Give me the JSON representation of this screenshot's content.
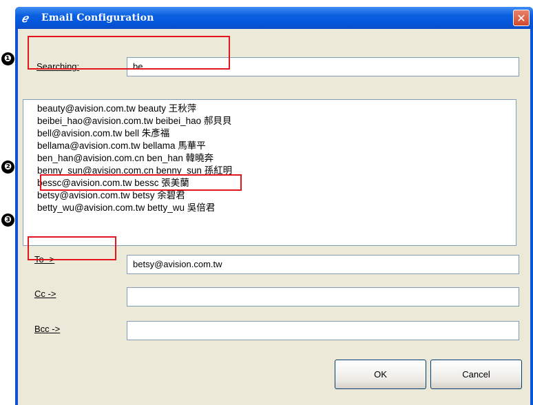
{
  "markers": [
    "❶",
    "❷",
    "❸"
  ],
  "window": {
    "title": "Email Configuration",
    "icon": "feather-pen-icon",
    "close_glyph": "✕"
  },
  "search": {
    "label": "Searching:",
    "value": "be"
  },
  "contacts": [
    "beauty@avision.com.tw beauty 王秋萍",
    "beibei_hao@avision.com.tw beibei_hao 郝貝貝",
    "bell@avision.com.tw bell 朱彥福",
    "bellama@avision.com.tw bellama 馬華平",
    "ben_han@avision.com.cn ben_han 韓曉奔",
    "benny_sun@avision.com.cn benny_sun 孫紅明",
    "bessc@avision.com.tw bessc 張美蘭",
    "betsy@avision.com.tw betsy 余碧君",
    "betty_wu@avision.com.tw betty_wu 吳倍君"
  ],
  "to": {
    "label": "To ->",
    "value": "betsy@avision.com.tw"
  },
  "cc": {
    "label": "Cc ->",
    "value": ""
  },
  "bcc": {
    "label": "Bcc ->",
    "value": ""
  },
  "buttons": {
    "ok": "OK",
    "cancel": "Cancel"
  },
  "colors": {
    "titlebar": "#0554d8",
    "client": "#ece9d8",
    "highlight": "#e3141b"
  }
}
